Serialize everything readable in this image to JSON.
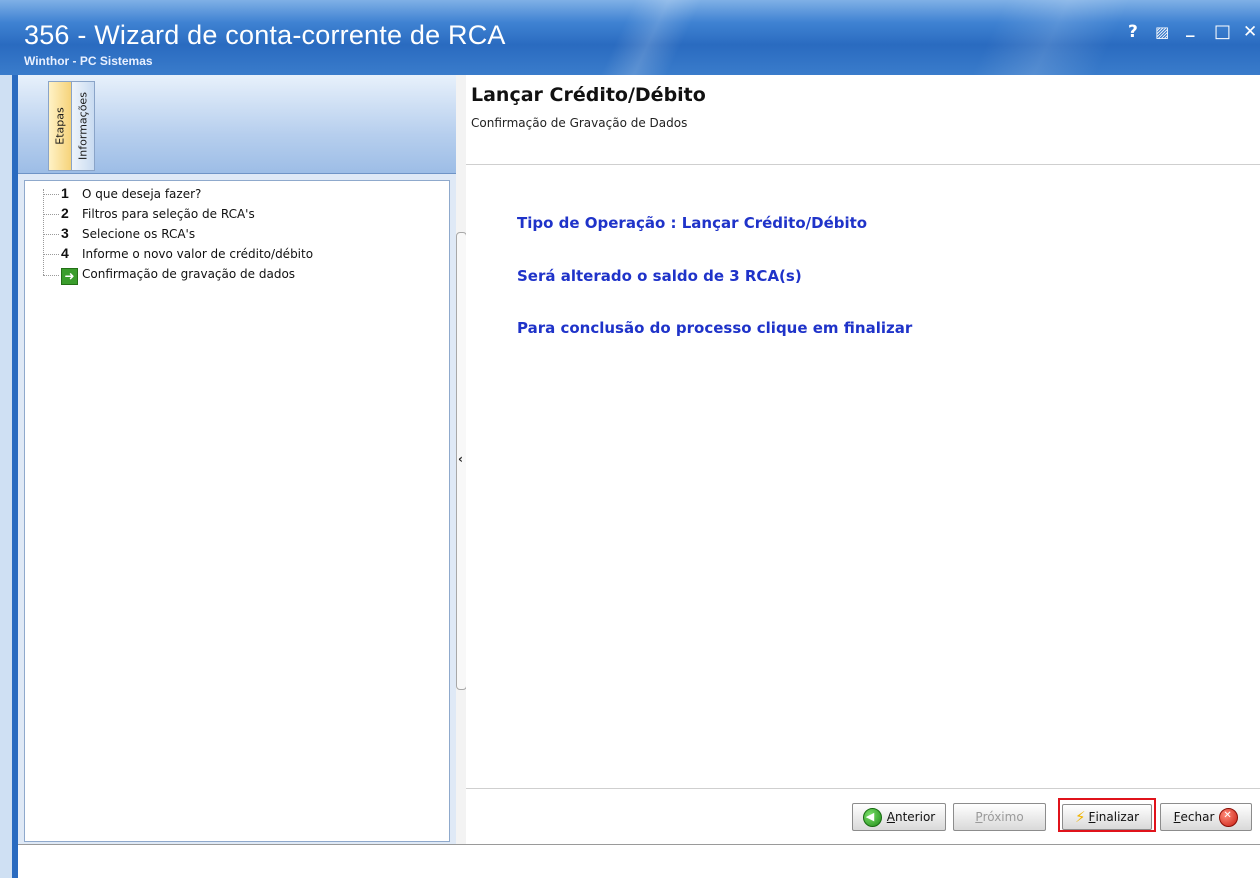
{
  "window": {
    "title": "356 - Wizard de conta-corrente de RCA",
    "subtitle": "Winthor - PC Sistemas",
    "controls": {
      "help": "?",
      "restore": "▨",
      "minimize": "_",
      "maximize": "□",
      "close": "✕"
    }
  },
  "left_panel": {
    "tabs": [
      {
        "label": "Etapas",
        "active": true
      },
      {
        "label": "Informações",
        "active": false
      }
    ],
    "steps": [
      {
        "number": "1",
        "label": "O que deseja fazer?"
      },
      {
        "number": "2",
        "label": "Filtros para seleção de RCA's"
      },
      {
        "number": "3",
        "label": "Selecione os RCA's"
      },
      {
        "number": "4",
        "label": "Informe o novo valor de crédito/débito"
      },
      {
        "number": "",
        "label": "Confirmação de gravação de dados",
        "current": true,
        "icon": "green-arrow-icon"
      }
    ]
  },
  "main": {
    "title": "Lançar Crédito/Débito",
    "subtitle": "Confirmação de Gravação de Dados",
    "messages": [
      "Tipo de Operação : Lançar Crédito/Débito",
      "Será alterado o saldo de 3 RCA(s)",
      "Para conclusão do processo clique em finalizar"
    ],
    "message_color": "#1f33c9"
  },
  "buttons": {
    "anterior": {
      "accel": "A",
      "rest": "nterior",
      "icon": "green-back-arrow-icon"
    },
    "proximo": {
      "accel": "P",
      "rest": "róximo",
      "enabled": false
    },
    "finalizar": {
      "accel": "F",
      "rest": "inalizar",
      "icon": "lightning-icon",
      "highlighted": true
    },
    "fechar": {
      "accel": "F",
      "rest": "echar",
      "icon": "red-close-icon"
    }
  },
  "colors": {
    "titlebar": "#2a6bc0",
    "highlight": "#e0131b"
  }
}
